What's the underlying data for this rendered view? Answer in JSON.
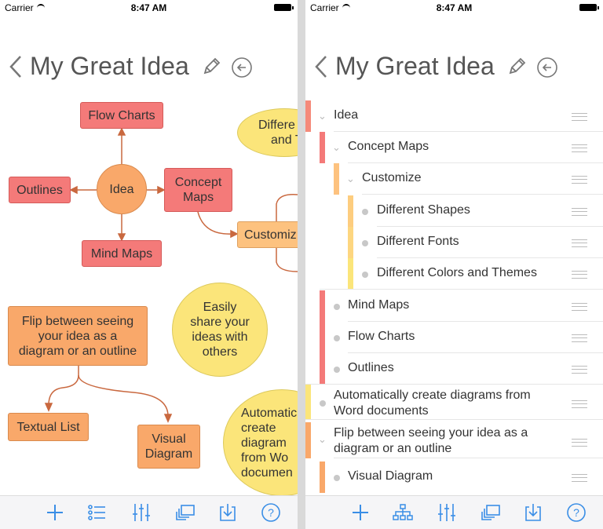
{
  "status": {
    "carrier": "Carrier",
    "time": "8:47 AM"
  },
  "nav": {
    "title": "My Great Idea"
  },
  "diagram": {
    "hub": "Idea",
    "flow_charts": "Flow Charts",
    "outlines": "Outlines",
    "concept_maps": "Concept Maps",
    "mind_maps": "Mind Maps",
    "customize": "Customiz",
    "different": "Differe",
    "and": "and T",
    "flip": "Flip between seeing your idea as a diagram or an outline",
    "textual_list": "Textual List",
    "visual_diagram": "Visual Diagram",
    "share": "Easily share your ideas with others",
    "automatic": "Automatic create diagram from Wo documen"
  },
  "outline": {
    "rows": [
      {
        "label": "Idea"
      },
      {
        "label": "Concept Maps"
      },
      {
        "label": "Customize"
      },
      {
        "label": "Different Shapes"
      },
      {
        "label": "Different Fonts"
      },
      {
        "label": "Different Colors and Themes"
      },
      {
        "label": "Mind Maps"
      },
      {
        "label": "Flow Charts"
      },
      {
        "label": "Outlines"
      },
      {
        "label": "Automatically create diagrams from Word documents"
      },
      {
        "label": "Flip between seeing your idea as a diagram or an outline"
      },
      {
        "label": "Visual Diagram"
      }
    ]
  },
  "colors": {
    "accent": "#3a8ee6",
    "red": "#f47a79",
    "orange": "#f9a86a",
    "yellow": "#fbe57a"
  }
}
